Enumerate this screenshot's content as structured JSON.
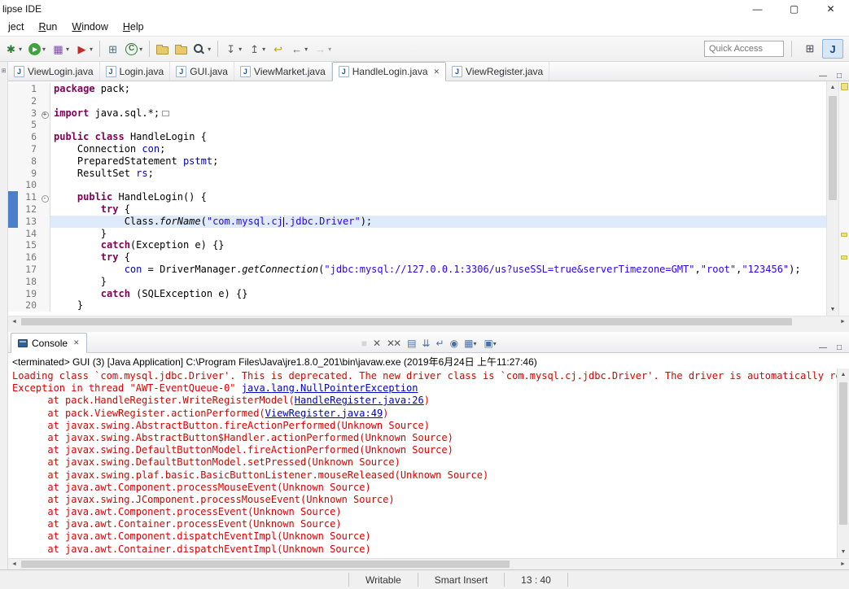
{
  "window": {
    "title": "lipse IDE",
    "controls": {
      "minimize": "—",
      "maximize": "▢",
      "close": "✕"
    }
  },
  "glyphs": {
    "dropdown": "▾",
    "up": "▲",
    "down": "▼",
    "left": "◄",
    "right": "►",
    "close": "✕",
    "panel_min": "—",
    "panel_max": "□",
    "rail": "⊞"
  },
  "menubar": [
    {
      "label": "ject",
      "mnemonic": false
    },
    {
      "label": "Run",
      "mnemonic": true
    },
    {
      "label": "Window",
      "mnemonic": true
    },
    {
      "label": "Help",
      "mnemonic": true
    }
  ],
  "toolbar": {
    "quick_access_placeholder": "Quick Access",
    "buttons": [
      {
        "name": "debug",
        "glyph": "✱",
        "color": "#2e7d32",
        "dropdown": true
      },
      {
        "name": "run",
        "glyph": "▶",
        "kind": "run",
        "dropdown": true
      },
      {
        "name": "coverage",
        "glyph": "▦",
        "color": "#7b4fa2",
        "dropdown": true
      },
      {
        "name": "external-tools",
        "glyph": "▶",
        "color": "#c62828",
        "dropdown": true
      },
      {
        "sep": true
      },
      {
        "name": "new-java-project",
        "glyph": "⊞",
        "color": "#546e7a"
      },
      {
        "name": "new-class",
        "glyph": "C",
        "color": "#2e7d32",
        "circle": true,
        "dropdown": true
      },
      {
        "sep": true
      },
      {
        "name": "open-task",
        "kind": "folder"
      },
      {
        "name": "open-resource",
        "kind": "folder"
      },
      {
        "name": "search",
        "kind": "mag",
        "dropdown": true
      },
      {
        "sep": true
      },
      {
        "name": "next-annotation",
        "glyph": "↧",
        "color": "#616161",
        "dropdown": true
      },
      {
        "name": "prev-annotation",
        "glyph": "↥",
        "color": "#616161",
        "dropdown": true
      },
      {
        "name": "last-edit-location",
        "glyph": "↩",
        "color": "#c8a200"
      },
      {
        "name": "back",
        "glyph": "←",
        "color": "#616161",
        "dropdown": true
      },
      {
        "name": "forward",
        "glyph": "→",
        "color": "#9e9e9e",
        "dropdown": true,
        "disabled": true
      }
    ],
    "perspectives": [
      {
        "name": "open-perspective",
        "glyph": "⊞",
        "active": false
      },
      {
        "name": "java-perspective",
        "glyph": "J",
        "active": true
      }
    ]
  },
  "editor": {
    "file_icon_glyph": "J",
    "tabs": [
      {
        "label": "ViewLogin.java",
        "active": false
      },
      {
        "label": "Login.java",
        "active": false
      },
      {
        "label": "GUI.java",
        "active": false
      },
      {
        "label": "ViewMarket.java",
        "active": false
      },
      {
        "label": "HandleLogin.java",
        "active": true
      },
      {
        "label": "ViewRegister.java",
        "active": false
      }
    ],
    "lines": [
      {
        "num": "1",
        "segments": [
          {
            "t": "k",
            "s": "package"
          },
          {
            "t": "p",
            "s": " pack;"
          }
        ]
      },
      {
        "num": "2",
        "segments": []
      },
      {
        "num": "3",
        "fold": "+",
        "segments": [
          {
            "t": "k",
            "s": "import"
          },
          {
            "t": "p",
            "s": " java.sql.*;"
          },
          {
            "t": "fb"
          }
        ]
      },
      {
        "num": "5",
        "segments": []
      },
      {
        "num": "6",
        "segments": [
          {
            "t": "k",
            "s": "public"
          },
          {
            "t": "p",
            "s": " "
          },
          {
            "t": "k",
            "s": "class"
          },
          {
            "t": "p",
            "s": " HandleLogin {"
          }
        ]
      },
      {
        "num": "7",
        "segments": [
          {
            "t": "p",
            "s": "    Connection "
          },
          {
            "t": "f",
            "s": "con"
          },
          {
            "t": "p",
            "s": ";"
          }
        ]
      },
      {
        "num": "8",
        "segments": [
          {
            "t": "p",
            "s": "    PreparedStatement "
          },
          {
            "t": "f",
            "s": "pstmt"
          },
          {
            "t": "p",
            "s": ";"
          }
        ]
      },
      {
        "num": "9",
        "segments": [
          {
            "t": "p",
            "s": "    ResultSet "
          },
          {
            "t": "f",
            "s": "rs"
          },
          {
            "t": "p",
            "s": ";"
          }
        ]
      },
      {
        "num": "10",
        "segments": []
      },
      {
        "num": "11",
        "fold": "-",
        "mark": true,
        "segments": [
          {
            "t": "p",
            "s": "    "
          },
          {
            "t": "k",
            "s": "public"
          },
          {
            "t": "p",
            "s": " HandleLogin() {"
          }
        ]
      },
      {
        "num": "12",
        "mark": true,
        "segments": [
          {
            "t": "p",
            "s": "        "
          },
          {
            "t": "k",
            "s": "try"
          },
          {
            "t": "p",
            "s": " {"
          }
        ]
      },
      {
        "num": "13",
        "mark": true,
        "current": true,
        "segments": [
          {
            "t": "p",
            "s": "            Class."
          },
          {
            "t": "m",
            "s": "forName"
          },
          {
            "t": "p",
            "s": "("
          },
          {
            "t": "s",
            "s": "\"com.mysql.cj"
          },
          {
            "t": "cur"
          },
          {
            "t": "s",
            "s": ".jdbc.Driver\""
          },
          {
            "t": "p",
            "s": ");"
          }
        ]
      },
      {
        "num": "14",
        "segments": [
          {
            "t": "p",
            "s": "        }"
          }
        ]
      },
      {
        "num": "15",
        "segments": [
          {
            "t": "p",
            "s": "        "
          },
          {
            "t": "k",
            "s": "catch"
          },
          {
            "t": "p",
            "s": "(Exception e) {}"
          }
        ]
      },
      {
        "num": "16",
        "segments": [
          {
            "t": "p",
            "s": "        "
          },
          {
            "t": "k",
            "s": "try"
          },
          {
            "t": "p",
            "s": " {"
          }
        ]
      },
      {
        "num": "17",
        "segments": [
          {
            "t": "p",
            "s": "            "
          },
          {
            "t": "f",
            "s": "con"
          },
          {
            "t": "p",
            "s": " = DriverManager."
          },
          {
            "t": "m",
            "s": "getConnection"
          },
          {
            "t": "p",
            "s": "("
          },
          {
            "t": "s",
            "s": "\"jdbc:mysql://127.0.0.1:3306/us?useSSL=true&serverTimezone=GMT\""
          },
          {
            "t": "p",
            "s": ","
          },
          {
            "t": "s",
            "s": "\"root\""
          },
          {
            "t": "p",
            "s": ","
          },
          {
            "t": "s",
            "s": "\"123456\""
          },
          {
            "t": "p",
            "s": ");"
          }
        ]
      },
      {
        "num": "18",
        "segments": [
          {
            "t": "p",
            "s": "        }"
          }
        ]
      },
      {
        "num": "19",
        "segments": [
          {
            "t": "p",
            "s": "        "
          },
          {
            "t": "k",
            "s": "catch"
          },
          {
            "t": "p",
            "s": " (SQLException e) {}"
          }
        ]
      },
      {
        "num": "20",
        "segments": [
          {
            "t": "p",
            "s": "    }"
          }
        ]
      }
    ]
  },
  "console": {
    "tab_label": "Console",
    "header": "<terminated> GUI (3) [Java Application] C:\\Program Files\\Java\\jre1.8.0_201\\bin\\javaw.exe (2019年6月24日 上午11:27:46)",
    "toolbar": [
      {
        "name": "terminate",
        "glyph": "■",
        "color": "#b9b9b9",
        "disabled": true
      },
      {
        "name": "remove-launch",
        "glyph": "✕",
        "color": "#5a5a5a"
      },
      {
        "name": "remove-all-terminated",
        "glyph": "✕✕",
        "color": "#5a5a5a"
      },
      {
        "name": "clear-console",
        "glyph": "▤",
        "color": "#4a6fa5"
      },
      {
        "name": "scroll-lock",
        "glyph": "⇊",
        "color": "#4a6fa5"
      },
      {
        "name": "word-wrap",
        "glyph": "↵",
        "color": "#4a6fa5"
      },
      {
        "name": "pin-console",
        "glyph": "◉",
        "color": "#4a6fa5"
      },
      {
        "name": "display-selected-console",
        "glyph": "▦",
        "color": "#4a6fa5",
        "dropdown": true
      },
      {
        "name": "open-console",
        "glyph": "▣",
        "color": "#4a6fa5",
        "dropdown": true
      }
    ],
    "lines": [
      [
        {
          "t": "r",
          "s": "Loading class `com.mysql.jdbc.Driver'. This is deprecated. The new driver class is `com.mysql.cj.jdbc.Driver'. The driver is automatically reg"
        }
      ],
      [
        {
          "t": "r",
          "s": "Exception in thread \"AWT-EventQueue-0\" "
        },
        {
          "t": "l",
          "s": "java.lang.NullPointerException"
        }
      ],
      [
        {
          "t": "r",
          "s": "      at pack.HandleRegister.WriteRegisterModel("
        },
        {
          "t": "l",
          "s": "HandleRegister.java:26"
        },
        {
          "t": "r",
          "s": ")"
        }
      ],
      [
        {
          "t": "r",
          "s": "      at pack.ViewRegister.actionPerformed("
        },
        {
          "t": "l",
          "s": "ViewRegister.java:49"
        },
        {
          "t": "r",
          "s": ")"
        }
      ],
      [
        {
          "t": "r",
          "s": "      at javax.swing.AbstractButton.fireActionPerformed(Unknown Source)"
        }
      ],
      [
        {
          "t": "r",
          "s": "      at javax.swing.AbstractButton$Handler.actionPerformed(Unknown Source)"
        }
      ],
      [
        {
          "t": "r",
          "s": "      at javax.swing.DefaultButtonModel.fireActionPerformed(Unknown Source)"
        }
      ],
      [
        {
          "t": "r",
          "s": "      at javax.swing.DefaultButtonModel.setPressed(Unknown Source)"
        }
      ],
      [
        {
          "t": "r",
          "s": "      at javax.swing.plaf.basic.BasicButtonListener.mouseReleased(Unknown Source)"
        }
      ],
      [
        {
          "t": "r",
          "s": "      at java.awt.Component.processMouseEvent(Unknown Source)"
        }
      ],
      [
        {
          "t": "r",
          "s": "      at javax.swing.JComponent.processMouseEvent(Unknown Source)"
        }
      ],
      [
        {
          "t": "r",
          "s": "      at java.awt.Component.processEvent(Unknown Source)"
        }
      ],
      [
        {
          "t": "r",
          "s": "      at java.awt.Container.processEvent(Unknown Source)"
        }
      ],
      [
        {
          "t": "r",
          "s": "      at java.awt.Component.dispatchEventImpl(Unknown Source)"
        }
      ],
      [
        {
          "t": "r",
          "s": "      at java.awt.Container.dispatchEventImpl(Unknown Source)"
        }
      ]
    ]
  },
  "statusbar": {
    "writable": "Writable",
    "insert_mode": "Smart Insert",
    "position": "13 : 40"
  },
  "colors": {
    "keyword": "#7f0055",
    "string": "#2a00ff",
    "field": "#0000c0",
    "stderr": "#dd0000",
    "link": "#0000cc",
    "current_line": "#dfeafb"
  }
}
